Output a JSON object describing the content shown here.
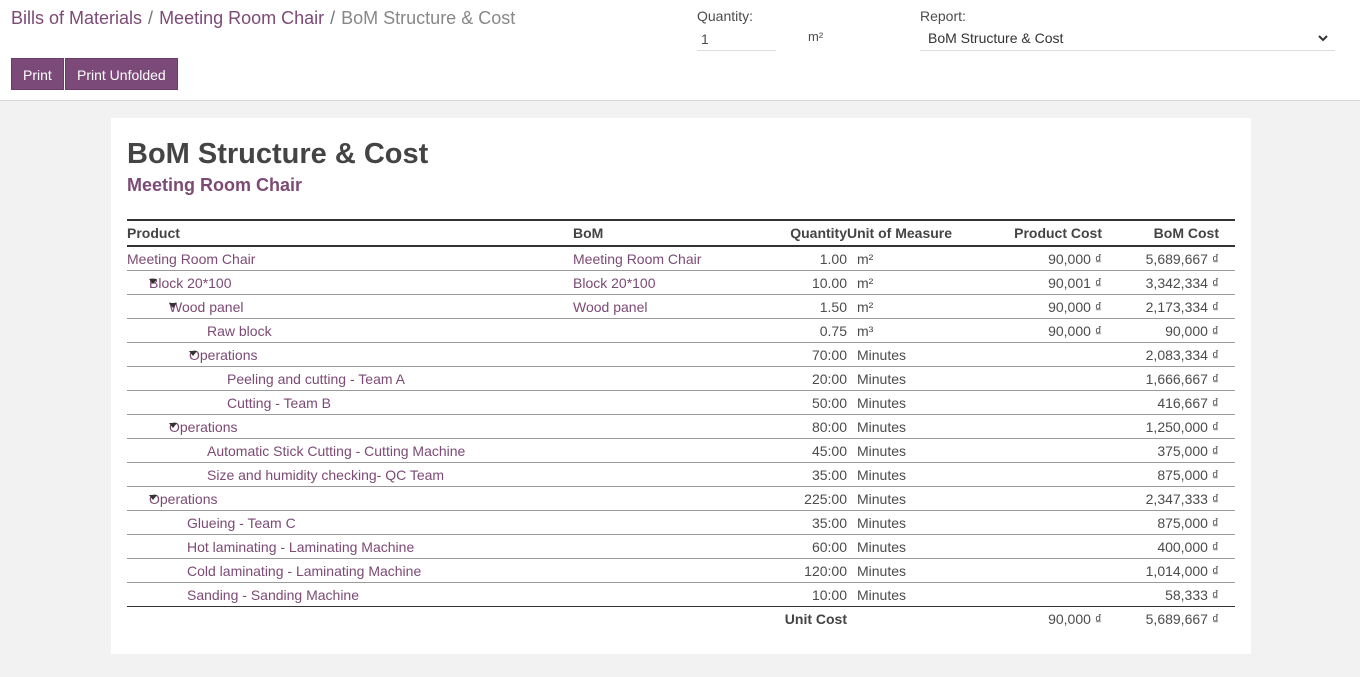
{
  "breadcrumb": {
    "items": [
      "Bills of Materials",
      "Meeting Room Chair"
    ],
    "separator": "/",
    "current": "BoM Structure & Cost"
  },
  "buttons": {
    "print": "Print",
    "print_unfolded": "Print Unfolded"
  },
  "quantity": {
    "label": "Quantity:",
    "value": "1",
    "uom": "m²"
  },
  "report": {
    "label": "Report:",
    "selected": "BoM Structure & Cost",
    "icon": "chevron-down-icon"
  },
  "sheet": {
    "title": "BoM Structure & Cost",
    "subtitle": "Meeting Room Chair"
  },
  "table": {
    "columns": {
      "product": "Product",
      "bom": "BoM",
      "quantity": "Quantity",
      "uom": "Unit of Measure",
      "product_cost": "Product Cost",
      "bom_cost": "BoM Cost"
    },
    "rows": [
      {
        "level": 0,
        "expandable": false,
        "product": "Meeting Room Chair",
        "bom": "Meeting Room Chair",
        "qty": "1.00",
        "uom": "m²",
        "pcost": "90,000 ₫",
        "bcost": "5,689,667 ₫"
      },
      {
        "level": 1,
        "expandable": true,
        "product": "Block 20*100",
        "bom": "Block 20*100",
        "qty": "10.00",
        "uom": "m²",
        "pcost": "90,001 ₫",
        "bcost": "3,342,334 ₫"
      },
      {
        "level": 2,
        "expandable": true,
        "product": "Wood panel",
        "bom": "Wood panel",
        "qty": "1.50",
        "uom": "m²",
        "pcost": "90,000 ₫",
        "bcost": "2,173,334 ₫"
      },
      {
        "level": 3,
        "expandable": false,
        "product": "Raw block",
        "bom": "",
        "qty": "0.75",
        "uom": "m³",
        "pcost": "90,000 ₫",
        "bcost": "90,000 ₫"
      },
      {
        "level": 3,
        "expandable": true,
        "product": "Operations",
        "bom": "",
        "qty": "70:00",
        "uom": "Minutes",
        "pcost": "",
        "bcost": "2,083,334 ₫"
      },
      {
        "level": 4,
        "expandable": false,
        "product": "Peeling and cutting - Team A",
        "bom": "",
        "qty": "20:00",
        "uom": "Minutes",
        "pcost": "",
        "bcost": "1,666,667 ₫"
      },
      {
        "level": 4,
        "expandable": false,
        "product": "Cutting - Team B",
        "bom": "",
        "qty": "50:00",
        "uom": "Minutes",
        "pcost": "",
        "bcost": "416,667 ₫"
      },
      {
        "level": 2,
        "expandable": true,
        "product": "Operations",
        "bom": "",
        "qty": "80:00",
        "uom": "Minutes",
        "pcost": "",
        "bcost": "1,250,000 ₫"
      },
      {
        "level": 3,
        "expandable": false,
        "product": "Automatic Stick Cutting - Cutting Machine",
        "bom": "",
        "qty": "45:00",
        "uom": "Minutes",
        "pcost": "",
        "bcost": "375,000 ₫"
      },
      {
        "level": 3,
        "expandable": false,
        "product": "Size and humidity checking- QC Team",
        "bom": "",
        "qty": "35:00",
        "uom": "Minutes",
        "pcost": "",
        "bcost": "875,000 ₫"
      },
      {
        "level": 1,
        "expandable": true,
        "product": "Operations",
        "bom": "",
        "qty": "225:00",
        "uom": "Minutes",
        "pcost": "",
        "bcost": "2,347,333 ₫"
      },
      {
        "level": 2,
        "expandable": false,
        "product": "Glueing - Team C",
        "bom": "",
        "qty": "35:00",
        "uom": "Minutes",
        "pcost": "",
        "bcost": "875,000 ₫"
      },
      {
        "level": 2,
        "expandable": false,
        "product": "Hot laminating - Laminating Machine",
        "bom": "",
        "qty": "60:00",
        "uom": "Minutes",
        "pcost": "",
        "bcost": "400,000 ₫"
      },
      {
        "level": 2,
        "expandable": false,
        "product": "Cold laminating - Laminating Machine",
        "bom": "",
        "qty": "120:00",
        "uom": "Minutes",
        "pcost": "",
        "bcost": "1,014,000 ₫"
      },
      {
        "level": 2,
        "expandable": false,
        "product": "Sanding - Sanding Machine",
        "bom": "",
        "qty": "10:00",
        "uom": "Minutes",
        "pcost": "",
        "bcost": "58,333 ₫"
      }
    ],
    "footer": {
      "label": "Unit Cost",
      "pcost": "90,000 ₫",
      "bcost": "5,689,667 ₫"
    }
  },
  "colors": {
    "brand": "#7c4a79",
    "link": "#7c4a75",
    "background": "#f2f2f2"
  }
}
